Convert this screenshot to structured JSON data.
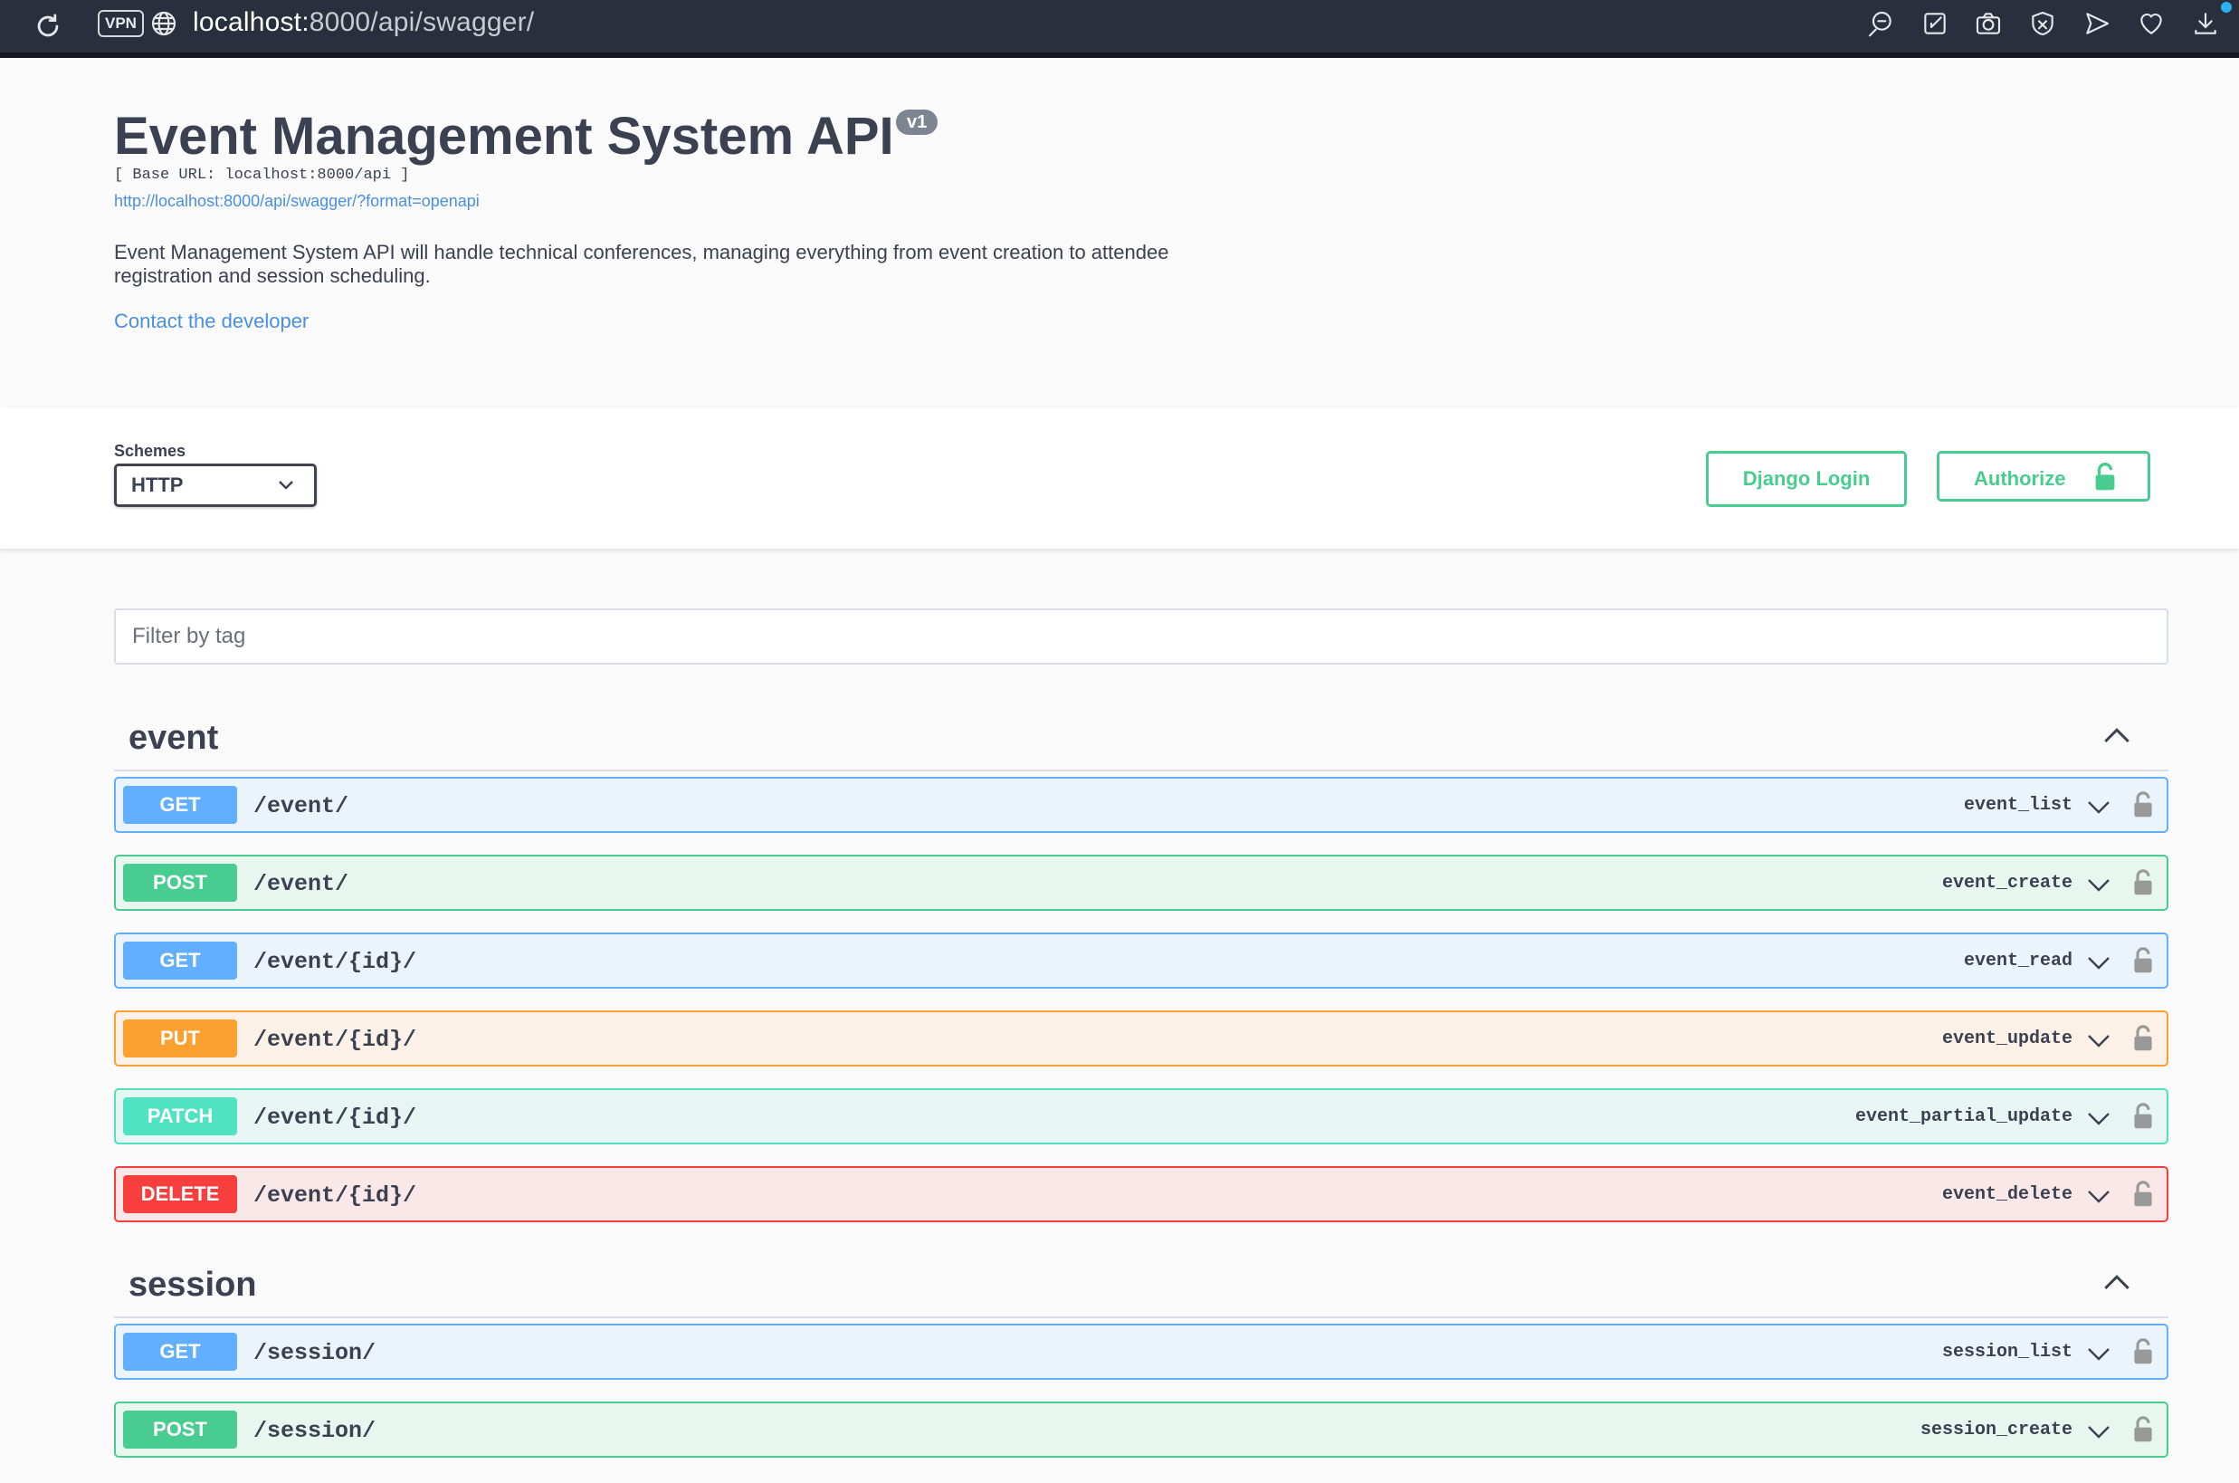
{
  "browser": {
    "vpn_label": "VPN",
    "url_host": "localhost:",
    "url_path": "8000/api/swagger/"
  },
  "info": {
    "title": "Event Management System API",
    "version": "v1",
    "base_url": "[ Base URL: localhost:8000/api ]",
    "spec_link": "http://localhost:8000/api/swagger/?format=openapi",
    "description": "Event Management System API will handle technical conferences, managing everything from event creation to attendee registration and session scheduling.",
    "contact": "Contact the developer"
  },
  "schemes": {
    "label": "Schemes",
    "selected": "HTTP"
  },
  "buttons": {
    "django_login": "Django Login",
    "authorize": "Authorize"
  },
  "filter": {
    "placeholder": "Filter by tag"
  },
  "tags": [
    {
      "name": "event",
      "operations": [
        {
          "method": "GET",
          "path": "/event/",
          "operation_id": "event_list"
        },
        {
          "method": "POST",
          "path": "/event/",
          "operation_id": "event_create"
        },
        {
          "method": "GET",
          "path": "/event/{id}/",
          "operation_id": "event_read"
        },
        {
          "method": "PUT",
          "path": "/event/{id}/",
          "operation_id": "event_update"
        },
        {
          "method": "PATCH",
          "path": "/event/{id}/",
          "operation_id": "event_partial_update"
        },
        {
          "method": "DELETE",
          "path": "/event/{id}/",
          "operation_id": "event_delete"
        }
      ]
    },
    {
      "name": "session",
      "operations": [
        {
          "method": "GET",
          "path": "/session/",
          "operation_id": "session_list"
        },
        {
          "method": "POST",
          "path": "/session/",
          "operation_id": "session_create"
        }
      ]
    }
  ],
  "colors": {
    "get": "#61affe",
    "post": "#49cc90",
    "put": "#fca130",
    "patch": "#50e3c2",
    "delete": "#f93e3e"
  }
}
